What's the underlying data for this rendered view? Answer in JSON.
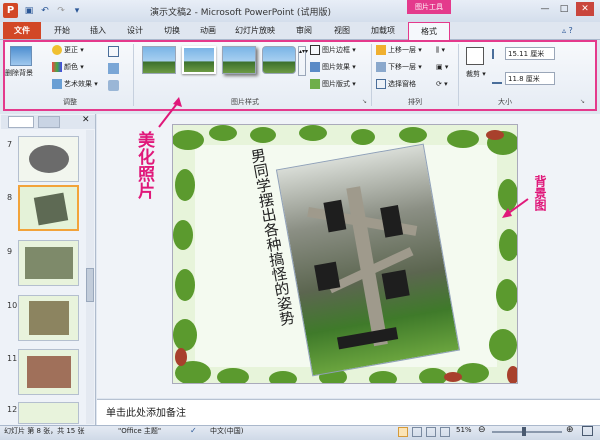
{
  "titlebar": {
    "app_icon": "P",
    "title": "演示文稿2 - Microsoft PowerPoint (试用版)",
    "context_tool": "图片工具"
  },
  "tabs": [
    "文件",
    "开始",
    "插入",
    "设计",
    "切换",
    "动画",
    "幻灯片放映",
    "审阅",
    "视图",
    "加载项",
    "格式"
  ],
  "ribbon": {
    "adjust": {
      "remove_bg": "删除背景",
      "corrections": "更正",
      "color": "颜色",
      "artistic": "艺术效果",
      "label": "调整"
    },
    "styles": {
      "label": "图片样式",
      "border": "图片边框",
      "effects": "图片效果",
      "layout": "图片版式"
    },
    "arrange": {
      "label": "排列",
      "bring_forward": "上移一层",
      "send_backward": "下移一层",
      "selection_pane": "选择窗格"
    },
    "size": {
      "label": "大小",
      "crop": "裁剪",
      "height": "15.11 厘米",
      "width": "11.8 厘米"
    }
  },
  "slides": [
    {
      "num": "7",
      "selected": false
    },
    {
      "num": "8",
      "selected": true
    },
    {
      "num": "9",
      "selected": false
    },
    {
      "num": "10",
      "selected": false
    },
    {
      "num": "11",
      "selected": false
    },
    {
      "num": "12",
      "selected": false
    }
  ],
  "slide": {
    "title_text": "男同学摆出各种搞怪的姿势",
    "theme_colors": {
      "frame_bg": "#e6f4d6",
      "leaf": "#5b9a2e",
      "accent": "#e0187a"
    }
  },
  "annotations": {
    "beautify": "美化照片",
    "background": "背景图"
  },
  "notes": {
    "placeholder": "单击此处添加备注"
  },
  "status": {
    "slide_info": "幻灯片 第 8 张，共 15 张",
    "theme": "\"Office 主题\"",
    "language": "中文(中国)",
    "zoom": "51%"
  }
}
